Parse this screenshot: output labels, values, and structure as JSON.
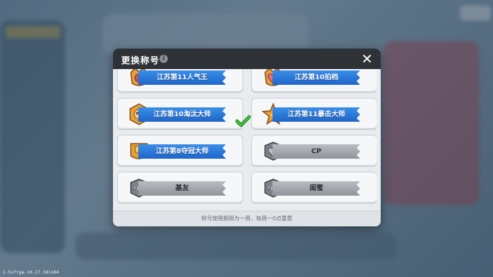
{
  "dialog": {
    "title": "更换称号",
    "close_label": "✕",
    "footer_text": "称号使用期限为一周，每周一0点重置"
  },
  "titles": [
    {
      "label": "江苏第11人气王",
      "style": "blue",
      "badge": "gold-crown-badge",
      "selected": false
    },
    {
      "label": "江苏第10拍档",
      "style": "blue",
      "badge": "gold-heart-badge",
      "selected": false
    },
    {
      "label": "江苏第10淘汰大师",
      "style": "blue",
      "badge": "gold-skull-badge",
      "selected": true
    },
    {
      "label": "江苏第11暴击大师",
      "style": "blue",
      "badge": "gold-star-badge",
      "selected": false
    },
    {
      "label": "江苏第8夺冠大师",
      "style": "blue",
      "badge": "gold-trophy-badge",
      "selected": false
    },
    {
      "label": "CP",
      "style": "gray",
      "badge": "gray-heart-badge",
      "selected": false
    },
    {
      "label": "基友",
      "style": "gray",
      "badge": "gray-99-badge",
      "selected": false
    },
    {
      "label": "闺蜜",
      "style": "gray",
      "badge": "gray-99-badge",
      "selected": false
    }
  ],
  "version_text": "2-5xftga-10.27.581484",
  "colors": {
    "ribbon_blue": "#2a7bdc",
    "ribbon_gray": "#a6abb1",
    "check_green": "#3fc23b",
    "header_dark": "#2e3237"
  }
}
